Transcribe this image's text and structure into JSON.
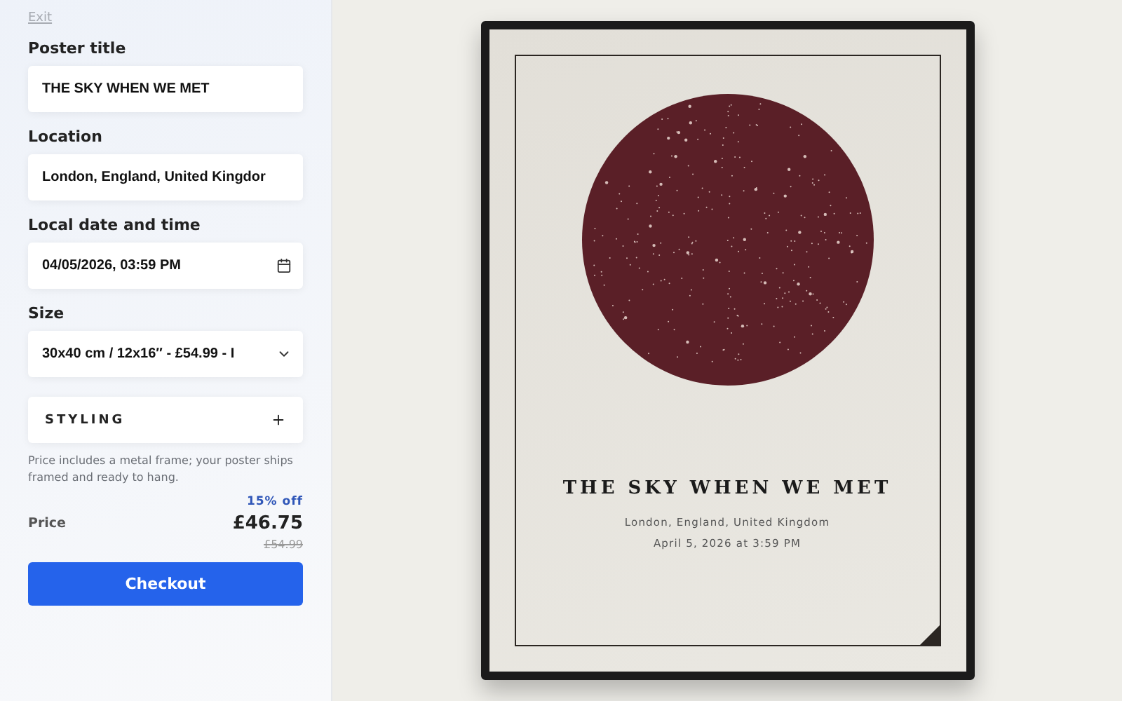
{
  "exit_link": "Exit",
  "form": {
    "fields": [
      {
        "kind": "text",
        "label": "Poster title",
        "value": "THE SKY WHEN WE MET"
      },
      {
        "kind": "text",
        "label": "Location",
        "value": "London, England, United Kingdor"
      },
      {
        "kind": "date",
        "label": "Local date and time",
        "value": "04/05/2026, 03:59 PM"
      },
      {
        "kind": "select",
        "label": "Size",
        "value": "30x40 cm / 12x16″ - £54.99 - I"
      }
    ],
    "styling": {
      "label": "STYLING",
      "expanded": false
    }
  },
  "note": "Price includes a metal frame; your poster ships framed and ready to hang.",
  "price": {
    "discount": "15% off",
    "label": "Price",
    "amount": "£46.75",
    "original": "£54.99"
  },
  "checkout_button": "Checkout",
  "poster": {
    "title": "THE SKY WHEN WE MET",
    "location": "London, England, United Kingdom",
    "datetime": "April 5, 2026 at 3:59 PM"
  }
}
